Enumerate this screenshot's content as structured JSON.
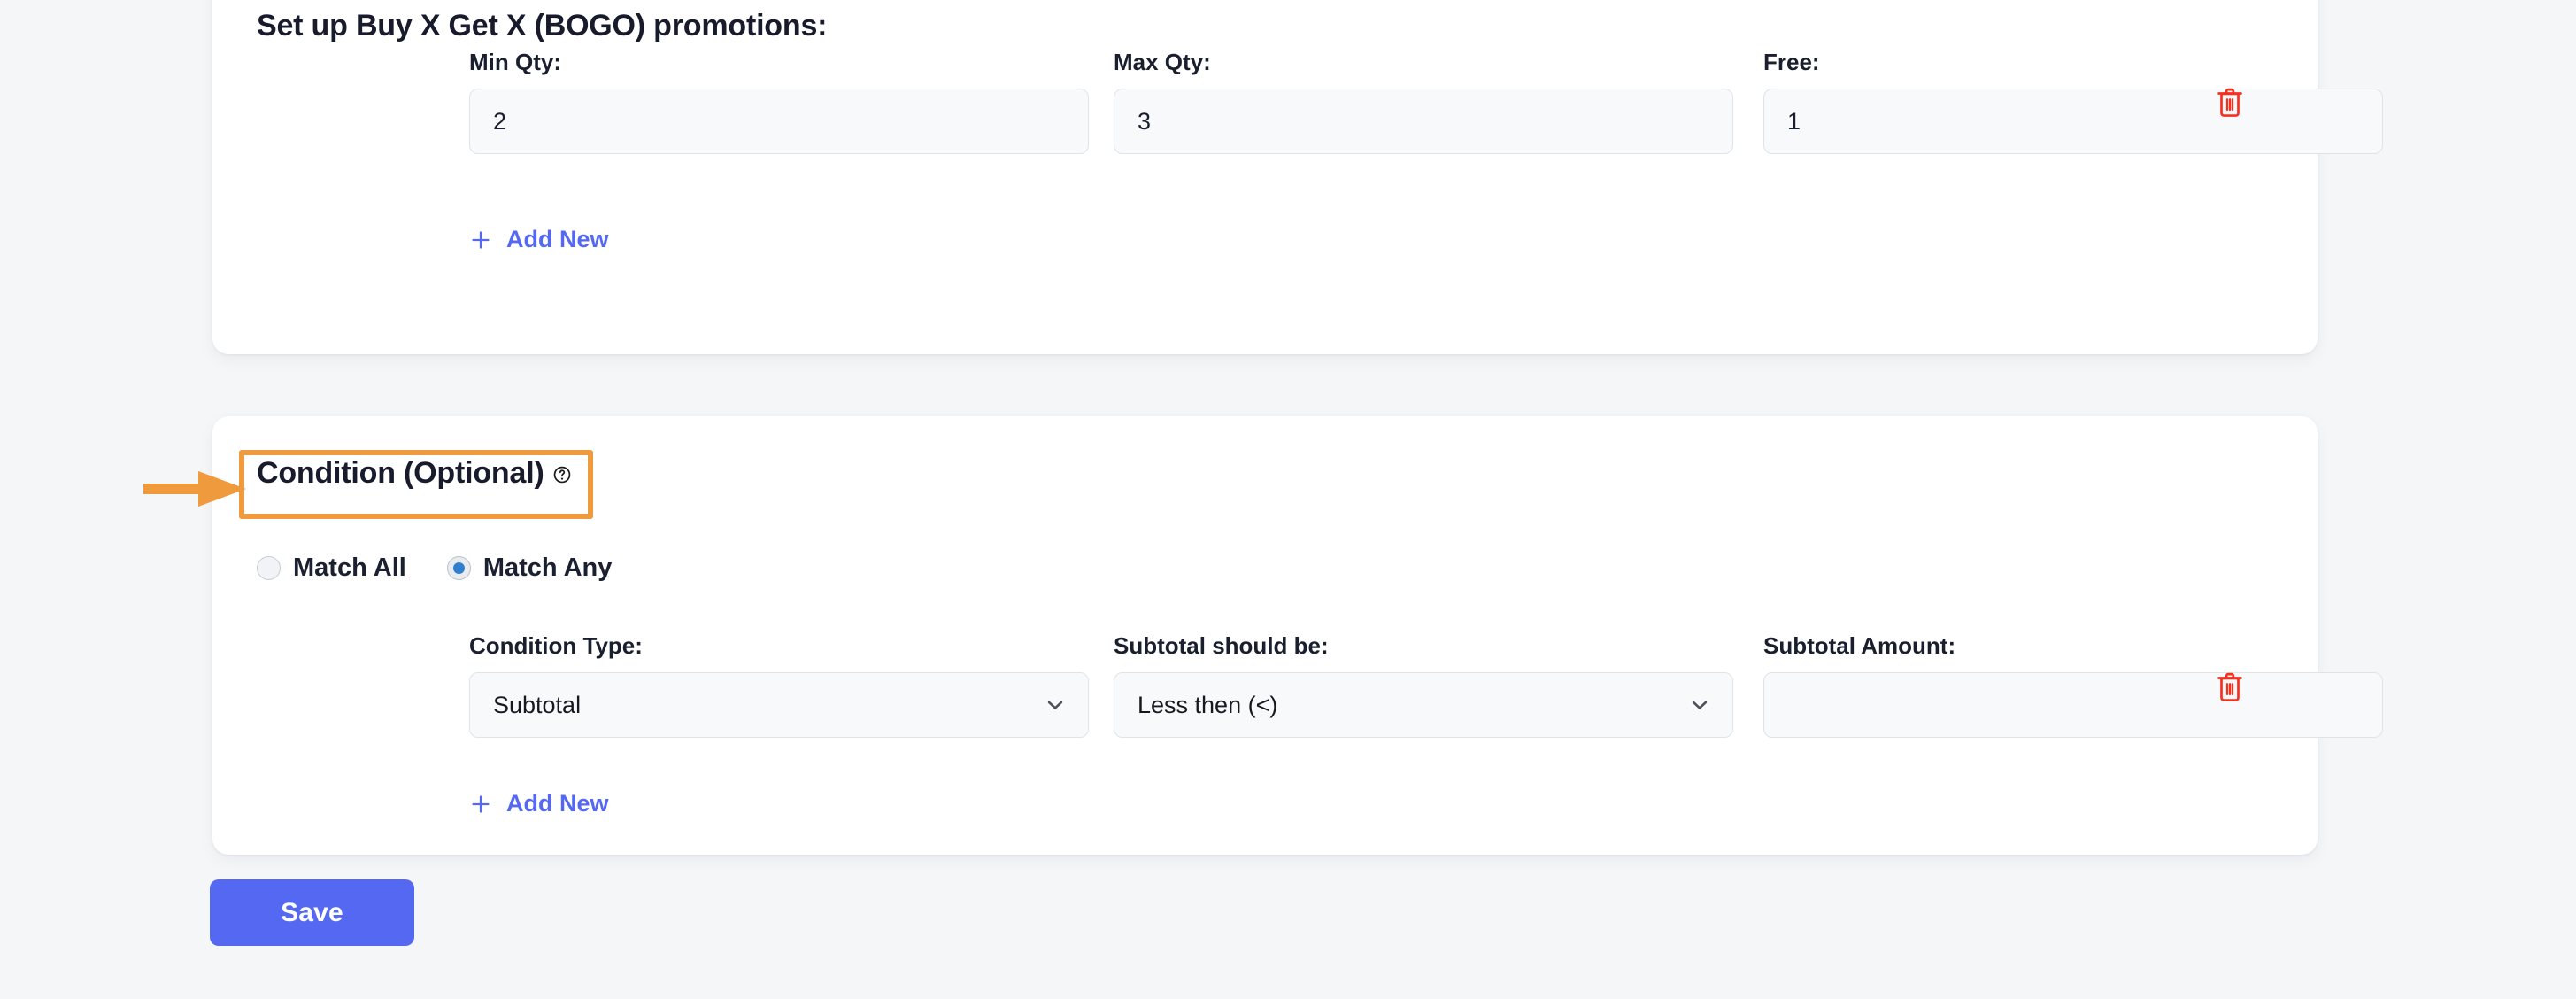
{
  "background_color": "#f4f6f8",
  "accent_color": "#5468f2",
  "highlight_color": "#ef9a3c",
  "danger_color": "#f72f1f",
  "bogo_card": {
    "title": "Set up Buy X Get X (BOGO) promotions:",
    "help_icon": "question-circle-icon",
    "fields": [
      {
        "label": "Min Qty:",
        "value": "2",
        "placeholder": ""
      },
      {
        "label": "Max Qty:",
        "value": "3",
        "placeholder": ""
      },
      {
        "label": "Free:",
        "value": "1",
        "placeholder": ""
      }
    ],
    "delete_icon": "trash-icon",
    "add_new": {
      "label": "Add New",
      "icon": "plus-icon"
    }
  },
  "condition_card": {
    "title": "Condition (Optional)",
    "help_icon": "question-circle-icon",
    "match_options": [
      {
        "label": "Match All",
        "selected": false
      },
      {
        "label": "Match Any",
        "selected": true
      }
    ],
    "fields": [
      {
        "label": "Condition Type:",
        "value": "Subtotal",
        "type": "select",
        "icon": "chevron-down-icon"
      },
      {
        "label": "Subtotal should be:",
        "value": "Less then (<)",
        "type": "select",
        "icon": "chevron-down-icon"
      },
      {
        "label": "Subtotal Amount:",
        "value": "",
        "type": "text",
        "placeholder": ""
      }
    ],
    "delete_icon": "trash-icon",
    "add_new": {
      "label": "Add New",
      "icon": "plus-icon"
    }
  },
  "footer": {
    "save_label": "Save"
  },
  "annotation": {
    "arrow_icon": "right-arrow-annotation",
    "highlight_target": "Condition (Optional)"
  }
}
